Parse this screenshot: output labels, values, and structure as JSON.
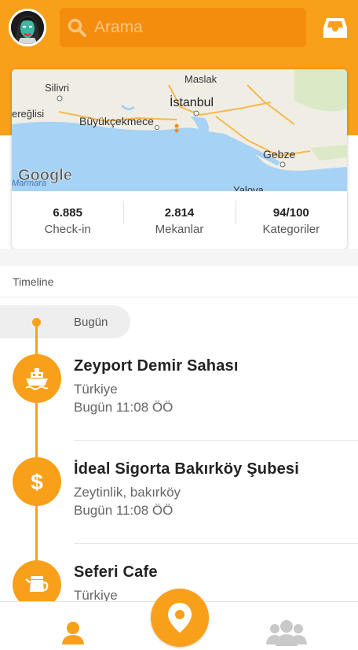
{
  "header": {
    "search_placeholder": "Arama"
  },
  "map": {
    "labels": {
      "silivri": "Silivri",
      "maslak": "Maslak",
      "istanbul": "İstanbul",
      "eregli": "ereğlisi",
      "buyukcekmece": "Büyükçekmece",
      "gebze": "Gebze",
      "yalova": "Yalova",
      "marmara": "Marmara"
    },
    "logo": "Google"
  },
  "stats": [
    {
      "value": "6.885",
      "label": "Check-in"
    },
    {
      "value": "2.814",
      "label": "Mekanlar"
    },
    {
      "value": "94/100",
      "label": "Kategoriler"
    }
  ],
  "timeline": {
    "title": "Timeline",
    "day": "Bugün",
    "items": [
      {
        "name": "Zeyport Demir Sahası",
        "location": "Türkiye",
        "time": "Bugün 11:08 ÖÖ",
        "icon": "ship-icon"
      },
      {
        "name": "İdeal Sigorta Bakırköy Şubesi",
        "location": "Zeytinlik, bakırköy",
        "time": "Bugün 11:08 ÖÖ",
        "icon": "dollar-icon"
      },
      {
        "name": "Seferi Cafe",
        "location": "Türkiye",
        "time": "",
        "icon": "teapot-icon"
      }
    ]
  },
  "colors": {
    "accent": "#f9a01b",
    "search_bg": "#f48d0e",
    "water": "#a6d2f5",
    "land": "#f0ede5"
  }
}
